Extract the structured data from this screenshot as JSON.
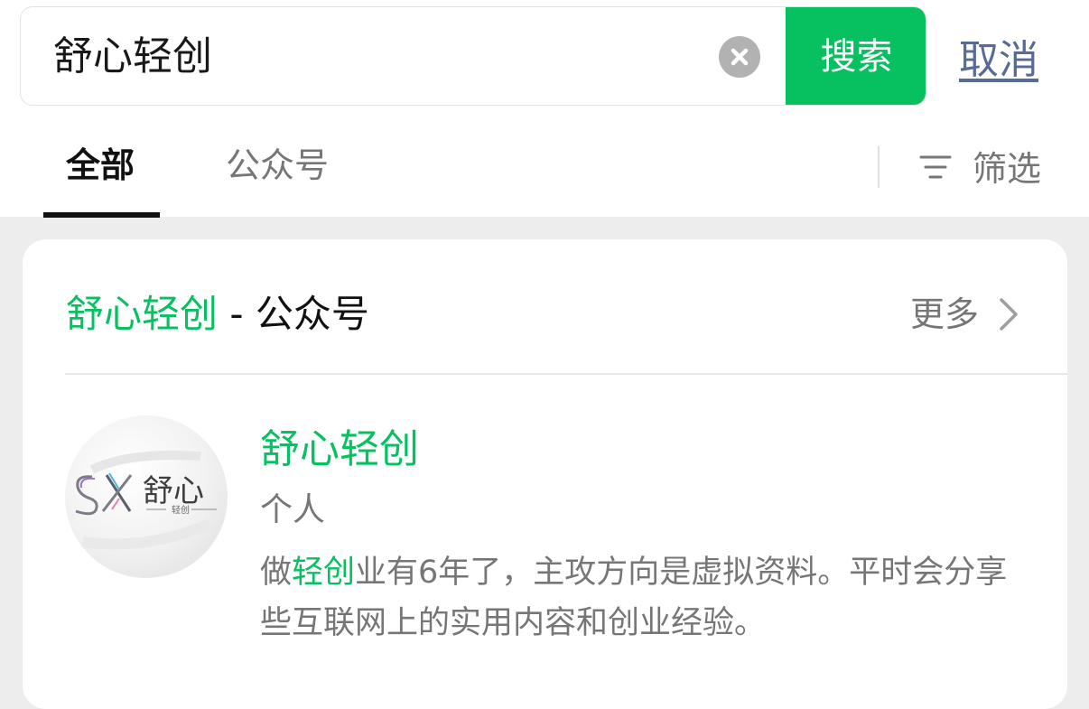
{
  "search": {
    "query": "舒心轻创",
    "clear_icon": "clear-icon",
    "button_label": "搜索",
    "cancel_label": "取消"
  },
  "tabs": [
    {
      "label": "全部",
      "active": true
    },
    {
      "label": "公众号",
      "active": false
    }
  ],
  "filter": {
    "icon": "filter-icon",
    "label": "筛选"
  },
  "section": {
    "highlight": "舒心轻创",
    "rest": " - 公众号",
    "more_label": "更多"
  },
  "result": {
    "avatar": {
      "logo_letters": "SX",
      "logo_name": "舒心",
      "logo_sub": "轻创"
    },
    "title": "舒心轻创",
    "type": "个人",
    "desc_prefix": "做",
    "desc_highlight": "轻创",
    "desc_suffix": "业有6年了，主攻方向是虚拟资料。平时会分享些互联网上的实用内容和创业经验。"
  },
  "colors": {
    "accent": "#07c160",
    "link": "#576b95",
    "muted": "#767676",
    "background": "#ededed"
  }
}
